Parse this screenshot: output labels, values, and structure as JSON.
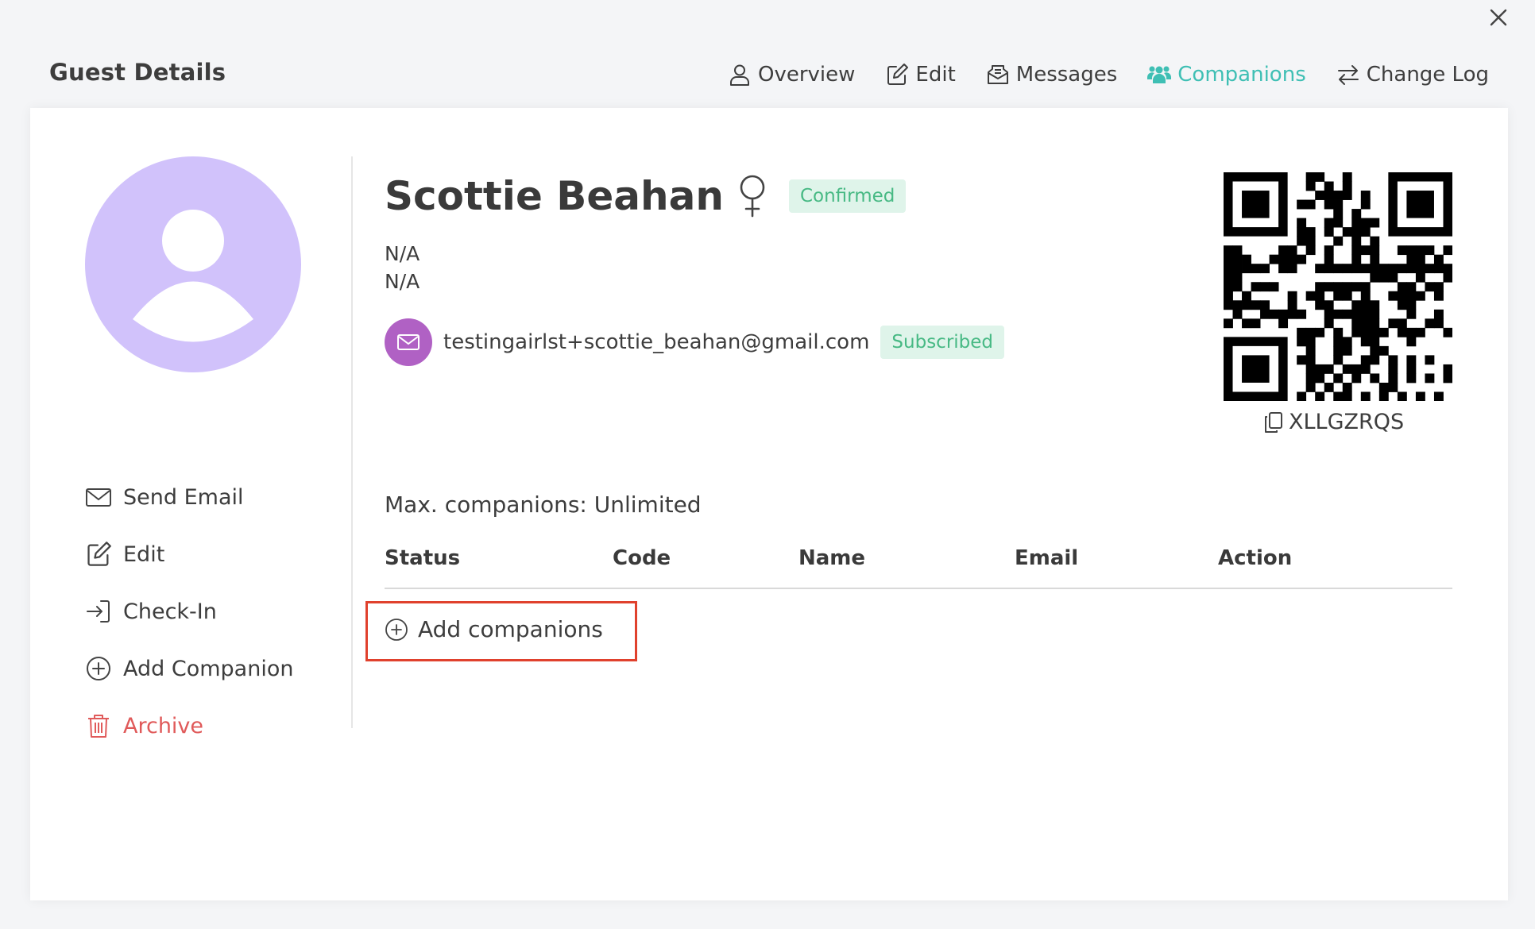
{
  "modal": {
    "title": "Guest Details",
    "close_icon": "close-icon"
  },
  "tabs": [
    {
      "label": "Overview",
      "icon": "person-icon",
      "active": false
    },
    {
      "label": "Edit",
      "icon": "edit-icon",
      "active": false
    },
    {
      "label": "Messages",
      "icon": "messages-icon",
      "active": false
    },
    {
      "label": "Companions",
      "icon": "people-icon",
      "active": true
    },
    {
      "label": "Change Log",
      "icon": "swap-arrows-icon",
      "active": false
    }
  ],
  "side_actions": [
    {
      "label": "Send Email",
      "icon": "mail-icon"
    },
    {
      "label": "Edit",
      "icon": "edit-icon"
    },
    {
      "label": "Check-In",
      "icon": "check-in-icon"
    },
    {
      "label": "Add Companion",
      "icon": "plus-circle-icon"
    },
    {
      "label": "Archive",
      "icon": "trash-icon",
      "danger": true
    }
  ],
  "guest": {
    "name": "Scottie Beahan",
    "gender_icon": "female-icon",
    "status": "Confirmed",
    "line1": "N/A",
    "line2": "N/A",
    "email": "testingairlst+scottie_beahan@gmail.com",
    "email_status": "Subscribed",
    "code": "XLLGZRQS"
  },
  "companions": {
    "max_text": "Max. companions: Unlimited",
    "columns": [
      "Status",
      "Code",
      "Name",
      "Email",
      "Action"
    ],
    "add_label": "Add companions"
  },
  "colors": {
    "accent": "#3fbfb4",
    "avatar": "#d1c2fb",
    "badge_bg": "#dff4ea",
    "badge_text": "#47b984",
    "mail_circle": "#b061c4",
    "danger": "#e05a5a",
    "highlight": "#e0412d"
  }
}
